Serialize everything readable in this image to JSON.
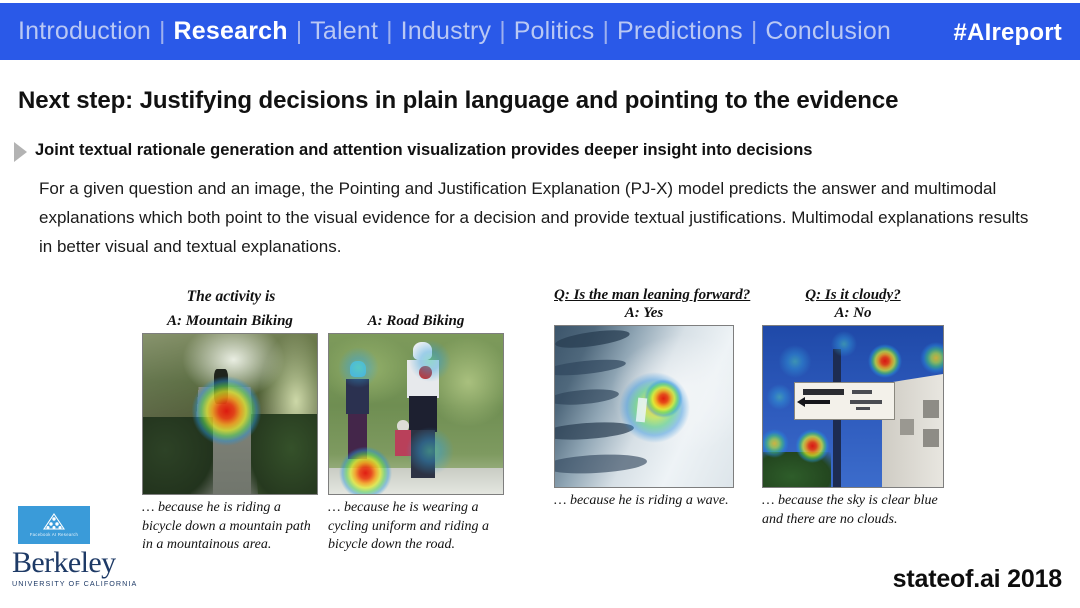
{
  "header": {
    "nav_items": [
      {
        "label": "Introduction",
        "active": false
      },
      {
        "label": "Research",
        "active": true
      },
      {
        "label": "Talent",
        "active": false
      },
      {
        "label": "Industry",
        "active": false
      },
      {
        "label": "Politics",
        "active": false
      },
      {
        "label": "Predictions",
        "active": false
      },
      {
        "label": "Conclusion",
        "active": false
      }
    ],
    "separator": "|",
    "hashtag": "#AIreport",
    "bar_color": "#2a59e8",
    "active_color": "#ffffff",
    "inactive_color": "#b9c8f4"
  },
  "slide": {
    "title": "Next step: Justifying decisions in plain language and pointing to the evidence",
    "subhead": "Joint textual rationale generation and attention visualization provides deeper insight into decisions",
    "body": "For a given question and an image, the Pointing and Justification Explanation (PJ-X) model predicts the answer and multimodal explanations which both point to the visual evidence for a decision and provide textual justifications. Multimodal explanations results in better visual and textual explanations."
  },
  "figure": {
    "group_heading": "The activity is",
    "panels": [
      {
        "label_line1": "A: Mountain Biking",
        "label_line2": "",
        "question": "",
        "caption": "… because he is riding a bicycle down a mountain path in a mountainous area."
      },
      {
        "label_line1": "A: Road Biking",
        "label_line2": "",
        "question": "",
        "caption": "… because he is wearing a cycling uniform and riding a bicycle down the road."
      },
      {
        "label_line1": "Q: Is the man leaning forward?",
        "label_line2": "A: Yes",
        "question": "Q: Is the man leaning forward?",
        "caption": "… because he is riding a wave."
      },
      {
        "label_line1": "Q: Is it cloudy?",
        "label_line2": "A: No",
        "question": "Q: Is it cloudy?",
        "caption": "… because the sky is clear blue and there are no clouds."
      }
    ]
  },
  "footer": {
    "fair_logo_caption": "Facebook AI Research",
    "berkeley_word": "Berkeley",
    "berkeley_sub": "UNIVERSITY OF CALIFORNIA",
    "stateof": "stateof.ai 2018"
  }
}
